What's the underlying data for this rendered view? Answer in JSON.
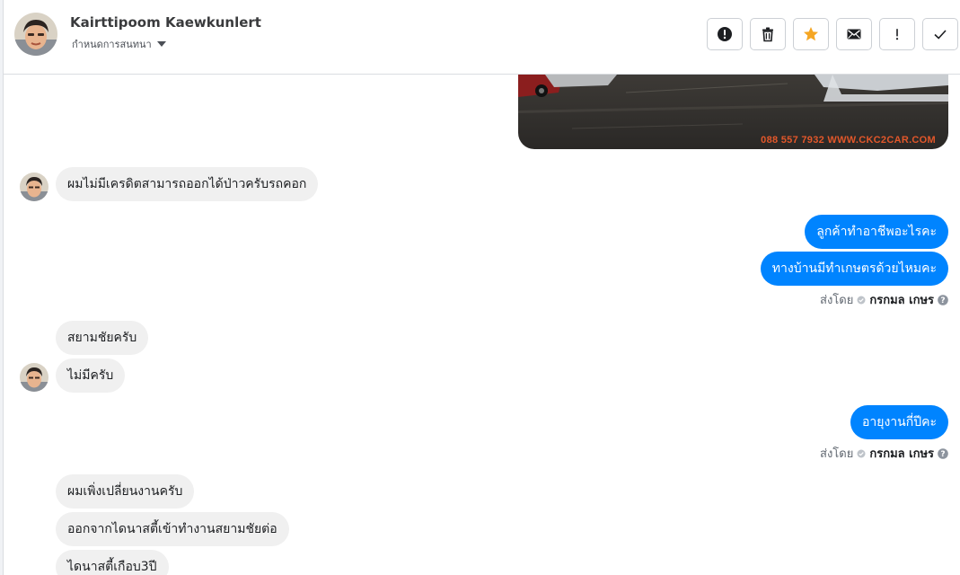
{
  "header": {
    "contact_name": "Kairttipoom Kaewkunlert",
    "subtitle": "กำหนดการสนทนา",
    "subtitle_icon": "caret-down-icon"
  },
  "toolbar": {
    "buttons": [
      {
        "name": "mark-spam-button",
        "icon": "alert-circle-icon"
      },
      {
        "name": "delete-button",
        "icon": "trash-icon"
      },
      {
        "name": "star-button",
        "icon": "star-icon",
        "color": "#f5a623"
      },
      {
        "name": "mark-unread-button",
        "icon": "envelope-icon"
      },
      {
        "name": "follow-up-button",
        "icon": "exclamation-icon"
      },
      {
        "name": "mark-done-button",
        "icon": "check-icon"
      }
    ]
  },
  "attachment": {
    "watermark": "088 557 7932 WWW.CKC2CAR.COM"
  },
  "messages": {
    "m1": "ผมไม่มีเครดิตสามารถออกได้ป่าวครับรถคอก",
    "m2": "ลูกค้าทำอาชีพอะไรคะ",
    "m3": "ทางบ้านมีทำเกษตรด้วยไหมคะ",
    "m4": "สยามชัยครับ",
    "m5": "ไม่มีครับ",
    "m6": "อายุงานกี่ปีคะ",
    "m7": "ผมเพิ่งเปลี่ยนงานครับ",
    "m8": "ออกจากไดนาสตี้เข้าทำงานสยามชัยต่อ",
    "m9": "ไดนาสตี้เกือบ3ปี"
  },
  "sent_by": {
    "label": "ส่งโดย",
    "agent": "กรกมล เกษร"
  },
  "colors": {
    "outgoing": "#0084ff",
    "incoming": "#f0f0f0",
    "accent_star": "#f5a623"
  }
}
